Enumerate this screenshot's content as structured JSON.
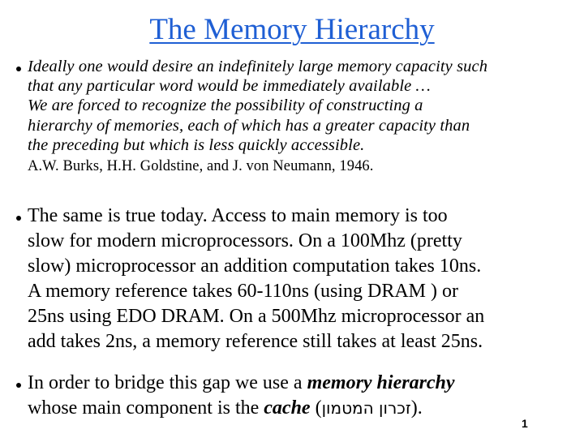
{
  "slide": {
    "title": "The Memory Hierarchy",
    "title_color": "#1f5fd4",
    "page_number": "1"
  },
  "bullets": [
    {
      "lines": [
        "Ideally one would desire an indefinitely large memory capacity such",
        "that any particular word would be immediately available …",
        "We are forced to recognize the possibility of constructing a",
        "hierarchy of memories, each of which has a greater capacity than",
        "the preceding but which is less quickly accessible."
      ],
      "attribution": "A.W. Burks, H.H. Goldstine, and J. von Neumann, 1946."
    },
    {
      "lines": [
        "The same is true today. Access to main memory is too",
        "slow for modern microprocessors. On a 100Mhz (pretty",
        "slow) microprocessor an addition computation takes 10ns.",
        "A memory reference takes 60-110ns (using DRAM ) or",
        "25ns using EDO DRAM. On a 500Mhz microprocessor an",
        "add takes 2ns, a memory reference still takes at least 25ns."
      ]
    },
    {
      "line1_prefix": "In order to bridge this gap we use a ",
      "line1_emphasis": "memory hierarchy",
      "line2_prefix": "whose main component is the ",
      "line2_emphasis": "cache",
      "line2_open": " (",
      "line2_hebrew": "זכרון המטמון",
      "line2_close": ")."
    }
  ]
}
